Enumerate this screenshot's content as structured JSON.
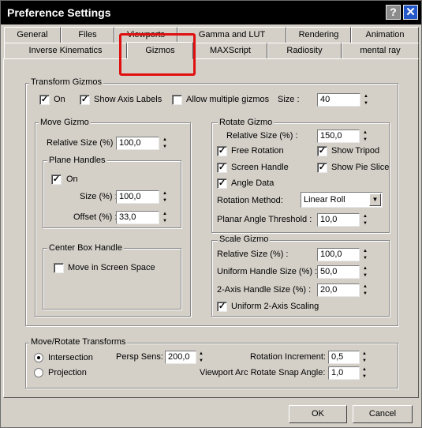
{
  "window": {
    "title": "Preference Settings",
    "help_label": "?",
    "close_label": "✕"
  },
  "tabs_row1": [
    {
      "label": "General"
    },
    {
      "label": "Files"
    },
    {
      "label": "Viewports"
    },
    {
      "label": "Gamma and LUT"
    },
    {
      "label": "Rendering"
    },
    {
      "label": "Animation"
    }
  ],
  "tabs_row2": [
    {
      "label": "Inverse Kinematics"
    },
    {
      "label": "Gizmos",
      "selected": true
    },
    {
      "label": "MAXScript"
    },
    {
      "label": "Radiosity"
    },
    {
      "label": "mental ray"
    }
  ],
  "transform_gizmos": {
    "title": "Transform Gizmos",
    "on_label": "On",
    "on_checked": true,
    "show_axis_labels_label": "Show Axis Labels",
    "show_axis_labels_checked": true,
    "allow_multiple_label": "Allow multiple gizmos",
    "allow_multiple_checked": false,
    "size_label": "Size :",
    "size_value": "40"
  },
  "move_gizmo": {
    "title": "Move Gizmo",
    "relative_size_label": "Relative Size (%) :",
    "relative_size_value": "100,0",
    "plane_handles": {
      "title": "Plane Handles",
      "on_label": "On",
      "on_checked": true,
      "size_label": "Size (%) :",
      "size_value": "100,0",
      "offset_label": "Offset (%) :",
      "offset_value": "33,0"
    },
    "center_box": {
      "title": "Center Box Handle",
      "move_screen_space_label": "Move in Screen Space",
      "move_screen_space_checked": false
    }
  },
  "rotate_gizmo": {
    "title": "Rotate Gizmo",
    "relative_size_label": "Relative Size (%) :",
    "relative_size_value": "150,0",
    "free_rotation_label": "Free Rotation",
    "free_rotation_checked": true,
    "show_tripod_label": "Show Tripod",
    "show_tripod_checked": true,
    "screen_handle_label": "Screen Handle",
    "screen_handle_checked": true,
    "show_pie_slice_label": "Show Pie Slice",
    "show_pie_slice_checked": true,
    "angle_data_label": "Angle Data",
    "angle_data_checked": true,
    "rotation_method_label": "Rotation Method:",
    "rotation_method_value": "Linear Roll",
    "planar_angle_label": "Planar Angle Threshold :",
    "planar_angle_value": "10,0"
  },
  "scale_gizmo": {
    "title": "Scale Gizmo",
    "relative_size_label": "Relative Size (%) :",
    "relative_size_value": "100,0",
    "uniform_handle_label": "Uniform Handle Size (%) :",
    "uniform_handle_value": "50,0",
    "two_axis_label": "2-Axis Handle Size (%) :",
    "two_axis_value": "20,0",
    "uniform_scaling_label": "Uniform 2-Axis Scaling",
    "uniform_scaling_checked": true
  },
  "move_rotate": {
    "title": "Move/Rotate Transforms",
    "intersection_label": "Intersection",
    "intersection_selected": true,
    "projection_label": "Projection",
    "projection_selected": false,
    "persp_sens_label": "Persp Sens:",
    "persp_sens_value": "200,0",
    "rotation_increment_label": "Rotation Increment:",
    "rotation_increment_value": "0,5",
    "arc_rotate_label": "Viewport Arc Rotate Snap Angle:",
    "arc_rotate_value": "1,0"
  },
  "buttons": {
    "ok": "OK",
    "cancel": "Cancel"
  },
  "colors": {
    "dialog_bg": "#d4d0c8",
    "titlebar": "#000000",
    "close_button": "#2457c8",
    "annotation": "#e01010"
  },
  "icons": {
    "help": "help-icon",
    "close": "close-icon",
    "dropdown": "chevron-down-icon"
  }
}
